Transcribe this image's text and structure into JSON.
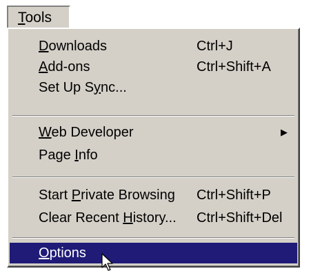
{
  "menubar": {
    "tools_label": "Tools"
  },
  "menu": {
    "items": [
      {
        "label": "Downloads",
        "shortcut": "Ctrl+J"
      },
      {
        "label": "Add-ons",
        "shortcut": "Ctrl+Shift+A"
      },
      {
        "label": "Set Up Sync...",
        "shortcut": ""
      },
      {
        "label": "Web Developer",
        "shortcut": ""
      },
      {
        "label": "Page Info",
        "shortcut": ""
      },
      {
        "label": "Start Private Browsing",
        "shortcut": "Ctrl+Shift+P"
      },
      {
        "label": "Clear Recent History...",
        "shortcut": "Ctrl+Shift+Del"
      },
      {
        "label": "Options",
        "shortcut": ""
      }
    ],
    "submenu_arrow_icon": "triangle-right-icon"
  },
  "colors": {
    "menu_bg": "#d4d0c8",
    "highlight": "#1f1b77",
    "highlight_text": "#ffffff"
  }
}
